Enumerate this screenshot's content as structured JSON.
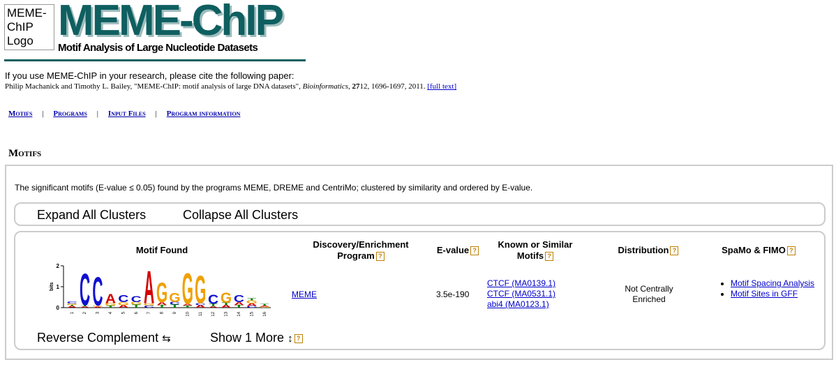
{
  "header": {
    "logo_box_lines": [
      "MEME-",
      "ChIP",
      "Logo"
    ],
    "title": "MEME-ChIP",
    "subtitle": "Motif Analysis of Large Nucleotide Datasets",
    "accent_color": "#0f5f60"
  },
  "citation": {
    "intro": "If you use MEME-ChIP in your research, please cite the following paper:",
    "authors": "Philip Machanick and Timothy L. Bailey, \"MEME-ChIP: motif analysis of large DNA datasets\", ",
    "journal": "Bioinformatics",
    "volume": "27",
    "rest": "12, 1696-1697, 2011. ",
    "link": "[full text]"
  },
  "nav": {
    "items": [
      "Motifs",
      "Programs",
      "Input Files",
      "Program information"
    ],
    "separator": "|"
  },
  "section": {
    "title": "Motifs",
    "description": "The significant motifs (E-value ≤ 0.05) found by the programs MEME, DREME and CentriMo; clustered by similarity and ordered by E-value."
  },
  "cluster_bar": {
    "expand_label": "Expand All Clusters",
    "collapse_label": "Collapse All Clusters"
  },
  "table": {
    "headers": {
      "motif": "Motif Found",
      "program": "Discovery/Enrichment Program",
      "evalue": "E-value",
      "known": "Known or Similar Motifs",
      "distribution": "Distribution",
      "spamo": "SpaMo & FIMO"
    },
    "help_glyph": "?",
    "row": {
      "program": "MEME",
      "evalue": "3.5e-190",
      "known_motifs": [
        "CTCF (MA0139.1)",
        "CTCF (MA0531.1)",
        "abi4 (MA0123.1)"
      ],
      "distribution": "Not Centrally Enriched",
      "spamo_links": [
        "Motif Spacing Analysis",
        "Motif Sites in GFF"
      ]
    },
    "logo": {
      "y_label": "bits",
      "y_ticks": [
        "2",
        "1",
        "0"
      ],
      "positions": [
        "1",
        "2",
        "3",
        "4",
        "5",
        "6",
        "7",
        "8",
        "9",
        "10",
        "11",
        "12",
        "13",
        "14",
        "15",
        "16"
      ],
      "base_colors": {
        "A": "#d40000",
        "C": "#1010d0",
        "G": "#f0a000",
        "T": "#008000"
      }
    },
    "footer": {
      "reverse_label": "Reverse Complement",
      "reverse_icon": "⇆",
      "more_label": "Show 1 More",
      "more_icon": "↕"
    }
  }
}
